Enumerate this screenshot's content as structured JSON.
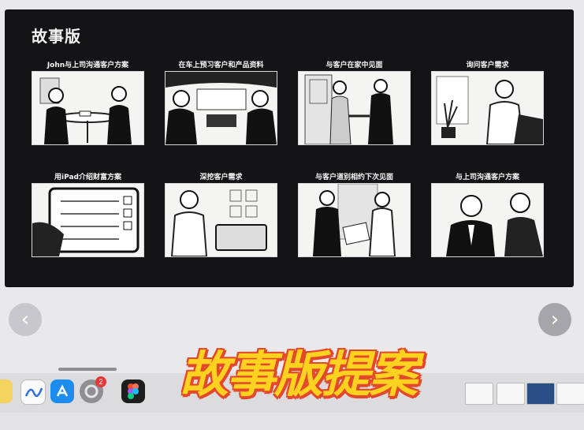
{
  "slide": {
    "title": "故事版",
    "panels": [
      {
        "caption": "John与上司沟通客户方案",
        "scene": "two-men-at-table"
      },
      {
        "caption": "在车上预习客户和产品资料",
        "scene": "car-interior"
      },
      {
        "caption": "与客户在家中见面",
        "scene": "handshake-doorway"
      },
      {
        "caption": "询问客户需求",
        "scene": "woman-talking"
      },
      {
        "caption": "用iPad介绍财富方案",
        "scene": "ipad-checklist"
      },
      {
        "caption": "深挖客户需求",
        "scene": "woman-with-tablet"
      },
      {
        "caption": "与客户道别相约下次见面",
        "scene": "man-woman-documents"
      },
      {
        "caption": "与上司沟通客户方案",
        "scene": "two-men-talking"
      }
    ]
  },
  "overlay_text": "故事版提案",
  "dock": {
    "badge_count": "2",
    "apps": [
      "notes-app-icon",
      "freeform-app-icon",
      "app-store-icon",
      "system-settings-icon",
      "figma-icon"
    ]
  },
  "icons": {
    "prev": "chevron-left-icon",
    "next": "chevron-right-icon"
  },
  "colors": {
    "slide_bg": "#141416",
    "overlay_fill": "#ffd21f",
    "overlay_outline": "#e4482b",
    "page_bg": "#e9e9eb"
  }
}
